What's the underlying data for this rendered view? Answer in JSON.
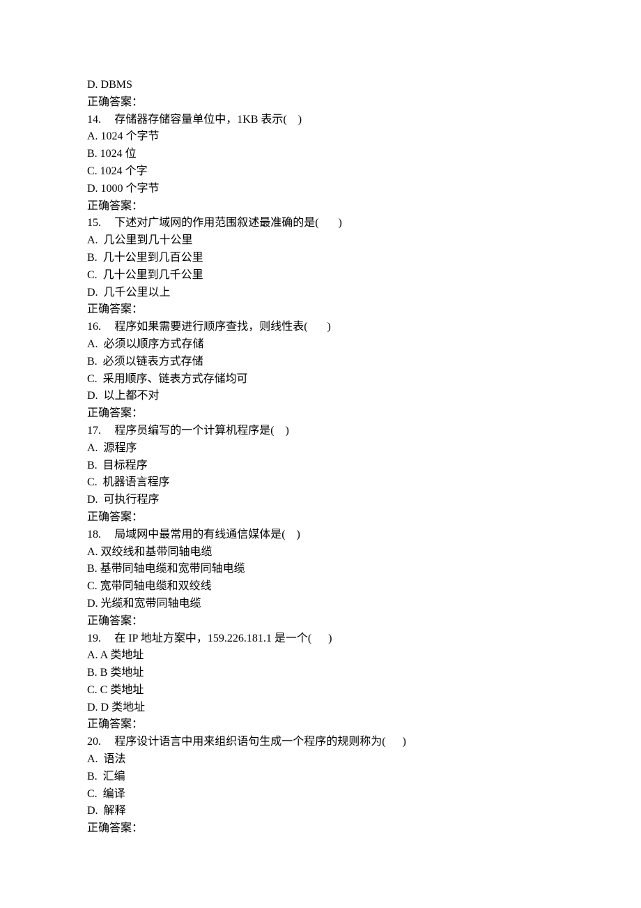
{
  "orphan_option": "D. DBMS",
  "answer_label": "正确答案：",
  "questions": [
    {
      "num": "14.",
      "text": "存储器存储容量单位中，1KB 表示(    )",
      "options": [
        "A. 1024 个字节",
        "B. 1024 位",
        "C. 1024 个字",
        "D. 1000 个字节"
      ],
      "answer": ""
    },
    {
      "num": "15.",
      "text": "下述对广域网的作用范围叙述最准确的是(       )",
      "options": [
        "A.  几公里到几十公里",
        "B.  几十公里到几百公里",
        "C.  几十公里到几千公里",
        "D.  几千公里以上"
      ],
      "answer": ""
    },
    {
      "num": "16.",
      "text": "程序如果需要进行顺序查找，则线性表(       )",
      "options": [
        "A.  必须以顺序方式存储",
        "B.  必须以链表方式存储",
        "C.  采用顺序、链表方式存储均可",
        "D.  以上都不对"
      ],
      "answer": ""
    },
    {
      "num": "17.",
      "text": "程序员编写的一个计算机程序是(    )",
      "options": [
        "A.  源程序",
        "B.  目标程序",
        "C.  机器语言程序",
        "D.  可执行程序"
      ],
      "answer": ""
    },
    {
      "num": "18.",
      "text": "局域网中最常用的有线通信媒体是(    )",
      "options": [
        "A. 双绞线和基带同轴电缆",
        "B. 基带同轴电缆和宽带同轴电缆",
        "C. 宽带同轴电缆和双绞线",
        "D. 光缆和宽带同轴电缆"
      ],
      "answer": ""
    },
    {
      "num": "19.",
      "text": "在 IP 地址方案中，159.226.181.1 是一个(      )",
      "options": [
        "A. A 类地址",
        "B. B 类地址",
        "C. C 类地址",
        "D. D 类地址"
      ],
      "answer": ""
    },
    {
      "num": "20.",
      "text": "程序设计语言中用来组织语句生成一个程序的规则称为(      )",
      "options": [
        "A.  语法",
        "B.  汇编",
        "C.  编译",
        "D.  解释"
      ],
      "answer": ""
    }
  ]
}
